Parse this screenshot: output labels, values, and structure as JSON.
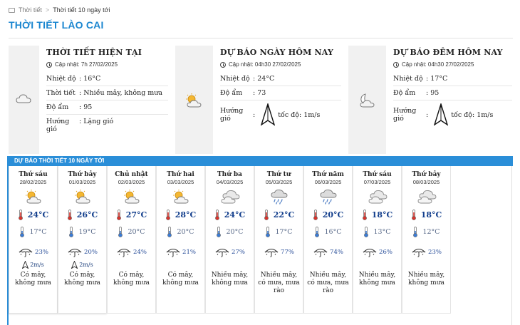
{
  "breadcrumb": {
    "root": "Thời tiết",
    "separator": ">",
    "current": "Thời tiết 10 ngày tới"
  },
  "page_title": "THỜI TIẾT LÀO CAI",
  "colors": {
    "accent": "#1a86d0",
    "bar": "#2a8ed8",
    "temp_high": "#123e8c"
  },
  "current": {
    "title": "THỜI TIẾT HIỆN TẠI",
    "updated": "Cập nhật: 7h 27/02/2025",
    "icon": "cloud-icon",
    "rows": [
      {
        "label": "Nhiệt độ",
        "value": ": 16°C"
      },
      {
        "label": "Thời tiết",
        "value": ": Nhiều mây, không mưa"
      },
      {
        "label": "Độ ẩm",
        "value": ": 95"
      },
      {
        "label": "Hướng gió",
        "value": ": Lặng gió"
      }
    ]
  },
  "today": {
    "title": "DỰ BÁO NGÀY HÔM NAY",
    "updated": "Cập nhật: 04h30 27/02/2025",
    "icon": "sun-cloud-icon",
    "rows": [
      {
        "label": "Nhiệt độ",
        "value": ": 24°C"
      },
      {
        "label": "Độ ẩm",
        "value": ": 73"
      },
      {
        "label": "Hướng gió",
        "value": ":",
        "wind": "tốc độ: 1m/s"
      }
    ]
  },
  "tonight": {
    "title": "DỰ BÁO ĐÊM HÔM NAY",
    "updated": "Cập nhật: 04h30 27/02/2025",
    "icon": "moon-cloud-icon",
    "rows": [
      {
        "label": "Nhiệt độ",
        "value": ": 17°C"
      },
      {
        "label": "Độ ẩm",
        "value": ": 95"
      },
      {
        "label": "Hướng gió",
        "value": ":",
        "wind": "tốc độ: 1m/s"
      }
    ]
  },
  "forecast_header": "DỰ BÁO THỜI TIẾT 10 NGÀY TỚI",
  "days": [
    {
      "name": "Thứ sáu",
      "date": "28/02/2025",
      "icon": "sun-cloud-icon",
      "high": "24°C",
      "low": "17°C",
      "rain": "23%",
      "wind": "2m/s",
      "cond1": "Có mây,",
      "cond2": "không mưa",
      "cond3": ""
    },
    {
      "name": "Thứ bảy",
      "date": "01/03/2025",
      "icon": "sun-cloud-icon",
      "high": "26°C",
      "low": "19°C",
      "rain": "20%",
      "wind": "2m/s",
      "cond1": "Có mây,",
      "cond2": "không mưa",
      "cond3": ""
    },
    {
      "name": "Chủ nhật",
      "date": "02/03/2025",
      "icon": "sun-cloud-icon",
      "high": "27°C",
      "low": "20°C",
      "rain": "24%",
      "wind": "",
      "cond1": "Có mây,",
      "cond2": "không mưa",
      "cond3": ""
    },
    {
      "name": "Thứ hai",
      "date": "03/03/2025",
      "icon": "sun-cloud-icon",
      "high": "28°C",
      "low": "20°C",
      "rain": "21%",
      "wind": "",
      "cond1": "Có mây,",
      "cond2": "không mưa",
      "cond3": ""
    },
    {
      "name": "Thứ ba",
      "date": "04/03/2025",
      "icon": "cloud-icon",
      "high": "24°C",
      "low": "20°C",
      "rain": "27%",
      "wind": "",
      "cond1": "Nhiều mây,",
      "cond2": "không mưa",
      "cond3": ""
    },
    {
      "name": "Thứ tư",
      "date": "05/03/2025",
      "icon": "rain-cloud-icon",
      "high": "22°C",
      "low": "17°C",
      "rain": "77%",
      "wind": "",
      "cond1": "Nhiều mây,",
      "cond2": "có mưa, mưa",
      "cond3": "rào"
    },
    {
      "name": "Thứ năm",
      "date": "06/03/2025",
      "icon": "rain-cloud-icon",
      "high": "20°C",
      "low": "16°C",
      "rain": "74%",
      "wind": "",
      "cond1": "Nhiều mây,",
      "cond2": "có mưa, mưa",
      "cond3": "rào"
    },
    {
      "name": "Thứ sáu",
      "date": "07/03/2025",
      "icon": "cloud-icon",
      "high": "18°C",
      "low": "13°C",
      "rain": "26%",
      "wind": "",
      "cond1": "Nhiều mây,",
      "cond2": "không mưa",
      "cond3": ""
    },
    {
      "name": "Thứ bảy",
      "date": "08/03/2025",
      "icon": "cloud-icon",
      "high": "18°C",
      "low": "12°C",
      "rain": "23%",
      "wind": "",
      "cond1": "Nhiều mây,",
      "cond2": "không mưa",
      "cond3": ""
    }
  ]
}
